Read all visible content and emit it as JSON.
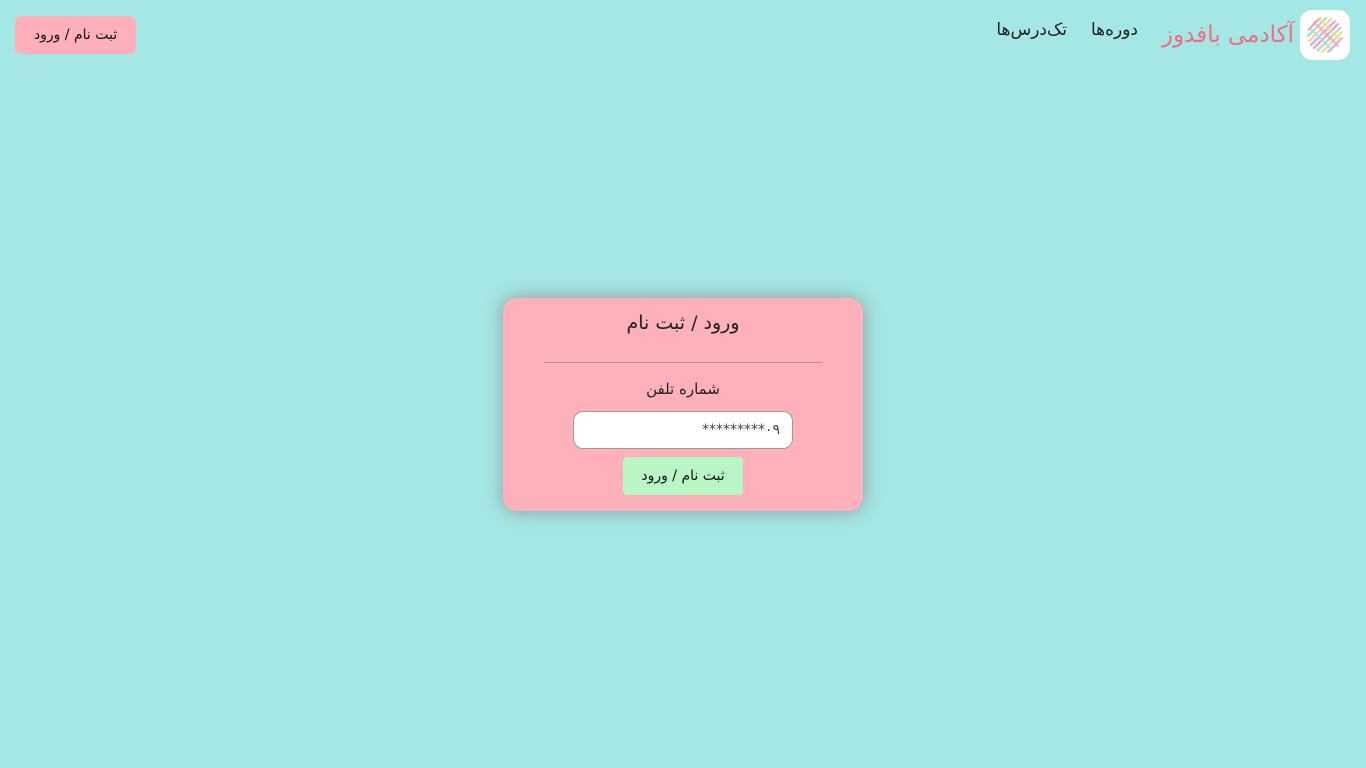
{
  "header": {
    "brand_title": "آکادمی بافدوز",
    "logo_icon": "yarn-stripes-logo-icon",
    "nav": [
      {
        "label": "دوره‌ها"
      },
      {
        "label": "تک‌درس‌ها"
      }
    ],
    "cta_label": "ثبت نام / ورود"
  },
  "login_card": {
    "title": "ورود / ثبت نام",
    "phone_label": "شماره تلفن",
    "phone_placeholder": "۰۹*********",
    "submit_label": "ثبت نام / ورود"
  },
  "colors": {
    "page_background": "#a4e7e4",
    "brand_text": "#ec6f86",
    "cta_background": "#ffb0bb",
    "card_background": "#ffb1bb",
    "submit_background": "#b9f5c5"
  }
}
